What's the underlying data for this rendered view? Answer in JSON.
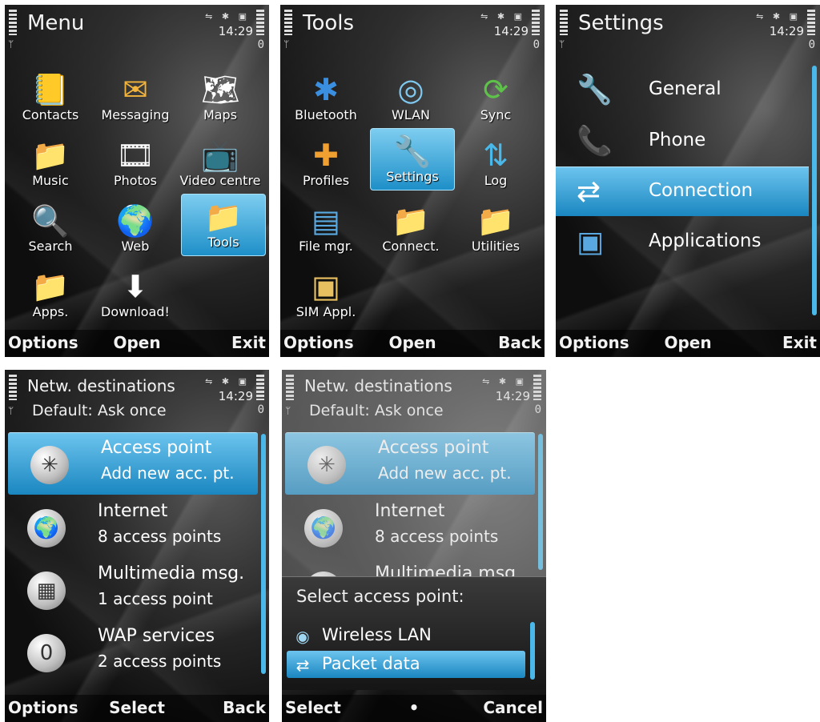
{
  "screens": {
    "menu": {
      "title": "Menu",
      "time": "14:29",
      "items": [
        {
          "label": "Contacts",
          "icon": "contacts-icon",
          "glyph": "📒"
        },
        {
          "label": "Messaging",
          "icon": "envelope-icon",
          "glyph": "✉"
        },
        {
          "label": "Maps",
          "icon": "map-icon",
          "glyph": "🗺"
        },
        {
          "label": "Music",
          "icon": "music-folder-icon",
          "glyph": "📁"
        },
        {
          "label": "Photos",
          "icon": "film-icon",
          "glyph": "🎞"
        },
        {
          "label": "Video centre",
          "icon": "video-icon",
          "glyph": "📺"
        },
        {
          "label": "Search",
          "icon": "magnifier-icon",
          "glyph": "🔍"
        },
        {
          "label": "Web",
          "icon": "globe-icon",
          "glyph": "🌍"
        },
        {
          "label": "Tools",
          "icon": "tools-folder-icon",
          "glyph": "📁"
        },
        {
          "label": "Apps.",
          "icon": "apps-folder-icon",
          "glyph": "📁"
        },
        {
          "label": "Download!",
          "icon": "download-icon",
          "glyph": "⬇"
        }
      ],
      "softkeys": {
        "left": "Options",
        "mid": "Open",
        "right": "Exit"
      }
    },
    "tools": {
      "title": "Tools",
      "time": "14:29",
      "items": [
        {
          "label": "Bluetooth",
          "icon": "bluetooth-icon",
          "glyph": "✱"
        },
        {
          "label": "WLAN",
          "icon": "wlan-icon",
          "glyph": "◎"
        },
        {
          "label": "Sync",
          "icon": "sync-icon",
          "glyph": "⟳"
        },
        {
          "label": "Profiles",
          "icon": "profiles-icon",
          "glyph": "✚"
        },
        {
          "label": "Settings",
          "icon": "wrench-icon",
          "glyph": "🔧"
        },
        {
          "label": "Log",
          "icon": "log-arrows-icon",
          "glyph": "⇅"
        },
        {
          "label": "File mgr.",
          "icon": "file-manager-icon",
          "glyph": "▤"
        },
        {
          "label": "Connect.",
          "icon": "connectivity-folder-icon",
          "glyph": "📁"
        },
        {
          "label": "Utilities",
          "icon": "utilities-folder-icon",
          "glyph": "📁"
        },
        {
          "label": "SIM Appl.",
          "icon": "sim-card-icon",
          "glyph": "▣"
        }
      ],
      "softkeys": {
        "left": "Options",
        "mid": "Open",
        "right": "Back"
      }
    },
    "settings": {
      "title": "Settings",
      "time": "14:29",
      "items": [
        {
          "label": "General",
          "icon": "general-settings-icon",
          "glyph": "🔧"
        },
        {
          "label": "Phone",
          "icon": "phone-settings-icon",
          "glyph": "📞"
        },
        {
          "label": "Connection",
          "icon": "connection-settings-icon",
          "glyph": "⇄"
        },
        {
          "label": "Applications",
          "icon": "applications-settings-icon",
          "glyph": "▣"
        }
      ],
      "softkeys": {
        "left": "Options",
        "mid": "Open",
        "right": "Exit"
      }
    },
    "destinations": {
      "title": "Netw. destinations",
      "subtitle": "Default: Ask once",
      "time": "14:29",
      "items": [
        {
          "line1": "Access point",
          "line2": "Add new acc. pt.",
          "icon": "access-point-icon",
          "glyph": "✳"
        },
        {
          "line1": "Internet",
          "line2": "8 access points",
          "icon": "globe-icon",
          "glyph": "🌍"
        },
        {
          "line1": "Multimedia msg.",
          "line2": "1 access point",
          "icon": "multimedia-icon",
          "glyph": "▦"
        },
        {
          "line1": "WAP services",
          "line2": "2 access points",
          "icon": "wap-icon",
          "glyph": "0"
        }
      ],
      "softkeys": {
        "left": "Options",
        "mid": "Select",
        "right": "Back"
      }
    },
    "popup_screen": {
      "title": "Netw. destinations",
      "subtitle": "Default: Ask once",
      "time": "14:29",
      "items": [
        {
          "line1": "Access point",
          "line2": "Add new acc. pt.",
          "icon": "access-point-icon",
          "glyph": "✳"
        },
        {
          "line1": "Internet",
          "line2": "8 access points",
          "icon": "globe-icon",
          "glyph": "🌍"
        },
        {
          "line1": "Multimedia msg.",
          "line2": "",
          "icon": "multimedia-icon",
          "glyph": ""
        }
      ],
      "popup": {
        "title": "Select access point:",
        "options": [
          {
            "label": "Wireless LAN",
            "icon": "wireless-lan-icon",
            "glyph": "◉"
          },
          {
            "label": "Packet data",
            "icon": "packet-data-icon",
            "glyph": "⇄"
          }
        ]
      },
      "softkeys": {
        "left": "Select",
        "mid": "•",
        "right": "Cancel"
      }
    }
  }
}
